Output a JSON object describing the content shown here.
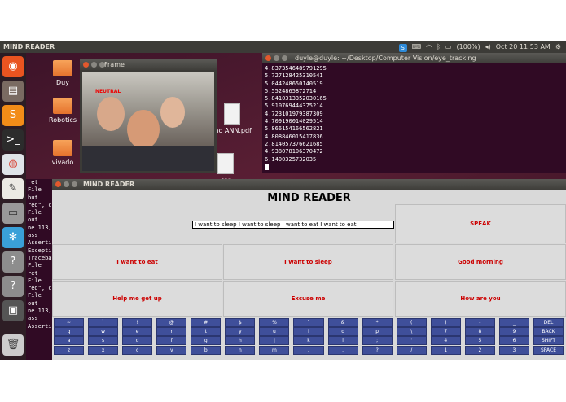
{
  "topbar": {
    "title": "MIND READER",
    "battery": "(100%)",
    "clock": "Oct 20 11:53 AM"
  },
  "launcher": {
    "icons": [
      "ubuntu-icon",
      "files-icon",
      "sublime-icon",
      "terminal-icon",
      "chrome-icon",
      "editor-icon",
      "drive-icon",
      "network-icon",
      "help-icon",
      "help-icon-2",
      "workspace-icon",
      "trash-icon"
    ]
  },
  "desktop": {
    "icons": [
      "Duy",
      "Robotics",
      "vivado",
      "ino ANN.pdf",
      "car"
    ]
  },
  "frame_window": {
    "title": "Frame",
    "overlay_text": "NEUTRAL"
  },
  "terminal": {
    "title": "duyle@duyle: ~/Desktop/Computer Vision/eye_tracking",
    "lines": [
      "4.8373546489791295",
      "5.727128425310541",
      "5.044248650140519",
      "5.5524865872714",
      "5.8410313352030165",
      "5.910769444375214",
      "4.723101979387309",
      "4.709190014029514",
      "5.866154166562821",
      "4.808846015417836",
      "2.814057376621685",
      "4.938078106370472",
      "6.1400325732035"
    ]
  },
  "left_terminal": {
    "lines": [
      "ret",
      "File",
      "but",
      "red\", c",
      "File",
      "out",
      "ne 113,",
      "ass",
      "Asserti",
      "Excepti",
      "Traceba",
      "File",
      "ret",
      "File",
      "red\", c",
      "File",
      "out",
      "ne 113,",
      "ass",
      "Asserti"
    ]
  },
  "mind_reader": {
    "window_title": "MIND READER",
    "heading": "MIND READER",
    "text_value": "I want to sleep I want to sleep I want to eat I want to eat",
    "speak": "SPEAK",
    "phrases": [
      "I want to eat",
      "I want to sleep",
      "Good morning",
      "Help me get up",
      "Excuse me",
      "How are you"
    ],
    "keys": [
      [
        "~",
        "`",
        "!",
        "@",
        "#",
        "$",
        "%",
        "^",
        "&",
        "*",
        "(",
        ")",
        "-",
        "_",
        "DEL"
      ],
      [
        "q",
        "w",
        "e",
        "r",
        "t",
        "y",
        "u",
        "i",
        "o",
        "p",
        "\\",
        "7",
        "8",
        "9",
        "BACK"
      ],
      [
        "a",
        "s",
        "d",
        "f",
        "g",
        "h",
        "j",
        "k",
        "l",
        ";",
        "'",
        "4",
        "5",
        "6",
        "SHIFT"
      ],
      [
        "z",
        "x",
        "c",
        "v",
        "b",
        "n",
        "m",
        ",",
        ".",
        "?",
        "/",
        "1",
        "2",
        "3",
        "SPACE"
      ]
    ]
  }
}
